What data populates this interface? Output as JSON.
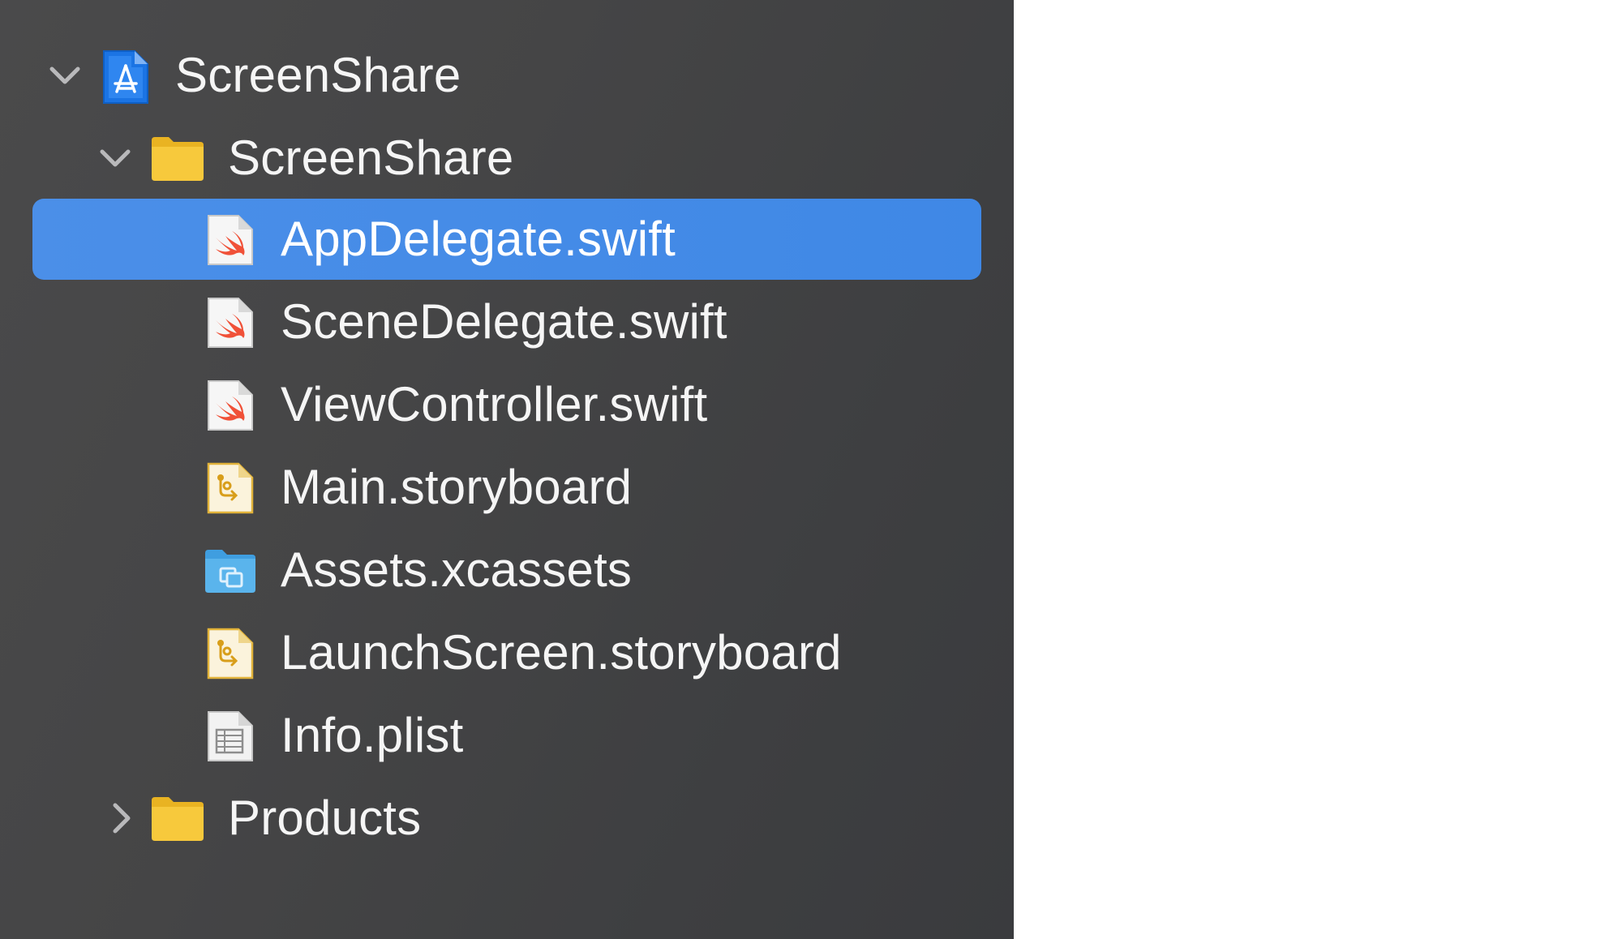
{
  "navigator": {
    "colors": {
      "background": "#454546",
      "selection": "#4088e6",
      "text": "#f5f5f5",
      "folder": "#f4c235",
      "swift": "#f05138",
      "assets": "#5ab4ec",
      "project": "#1b74e4"
    },
    "project": {
      "label": "ScreenShare",
      "icon": "xcode-project-icon",
      "expanded": true
    },
    "group": {
      "label": "ScreenShare",
      "icon": "folder-icon",
      "expanded": true
    },
    "files": [
      {
        "label": "AppDelegate.swift",
        "icon": "swift-file-icon",
        "selected": true
      },
      {
        "label": "SceneDelegate.swift",
        "icon": "swift-file-icon",
        "selected": false
      },
      {
        "label": "ViewController.swift",
        "icon": "swift-file-icon",
        "selected": false
      },
      {
        "label": "Main.storyboard",
        "icon": "storyboard-file-icon",
        "selected": false
      },
      {
        "label": "Assets.xcassets",
        "icon": "asset-catalog-icon",
        "selected": false
      },
      {
        "label": "LaunchScreen.storyboard",
        "icon": "storyboard-file-icon",
        "selected": false
      },
      {
        "label": "Info.plist",
        "icon": "plist-file-icon",
        "selected": false
      }
    ],
    "products": {
      "label": "Products",
      "icon": "folder-icon",
      "expanded": false
    }
  }
}
